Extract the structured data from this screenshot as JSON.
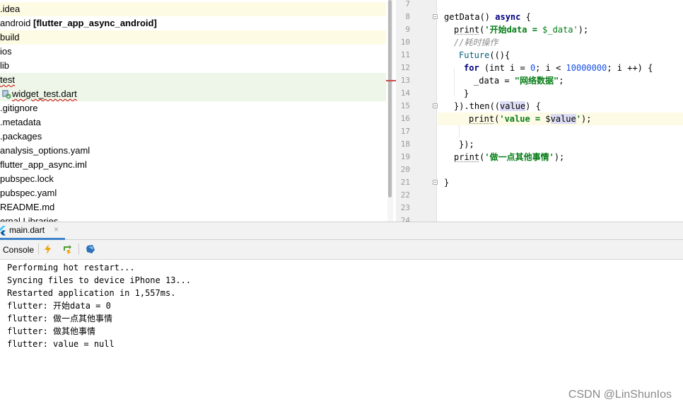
{
  "project_tree": {
    "items": [
      {
        "label": ".idea"
      },
      {
        "label": "android",
        "suffix": "[flutter_app_async_android]"
      },
      {
        "label": "build"
      },
      {
        "label": "ios"
      },
      {
        "label": "lib"
      },
      {
        "label": "test"
      },
      {
        "label": "widget_test.dart"
      },
      {
        "label": ".gitignore"
      },
      {
        "label": ".metadata"
      },
      {
        "label": ".packages"
      },
      {
        "label": "analysis_options.yaml"
      },
      {
        "label": "flutter_app_async.iml"
      },
      {
        "label": "pubspec.lock"
      },
      {
        "label": "pubspec.yaml"
      },
      {
        "label": "README.md"
      },
      {
        "label": "ernal Libraries"
      }
    ]
  },
  "editor": {
    "line_numbers": [
      "7",
      "8",
      "9",
      "10",
      "11",
      "12",
      "13",
      "14",
      "15",
      "16",
      "17",
      "18",
      "19",
      "20",
      "21",
      "22",
      "23",
      "24"
    ],
    "code": {
      "l8_a": "getData() ",
      "l8_kw": "async",
      "l8_b": " {",
      "l9_a": "print",
      "l9_b": "(",
      "l9_s": "'开始data = ",
      "l9_s2": "$_data'",
      "l9_c": ");",
      "l10": "//耗时操作",
      "l11_a": "Future",
      "l11_b": "((){",
      "l12_kw": "for",
      "l12_a": " (int i = ",
      "l12_n1": "0",
      "l12_b": "; i < ",
      "l12_n2": "10000000",
      "l12_c": "; i ++) {",
      "l13_a": "_data = ",
      "l13_s": "\"网络数据\"",
      "l13_b": ";",
      "l14": "}",
      "l15_a": "}).then((",
      "l15_v": "value",
      "l15_b": ") {",
      "l16_a": "print",
      "l16_b": "(",
      "l16_s": "'value = ",
      "l16_d": "$",
      "l16_v": "value",
      "l16_s2": "'",
      "l16_c": ");",
      "l18": "});",
      "l19_a": "print",
      "l19_b": "(",
      "l19_s": "'做一点其他事情'",
      "l19_c": ");",
      "l21": "}"
    }
  },
  "run_panel": {
    "tab_label": "main.dart",
    "tab_close": "×",
    "console_label": "Console",
    "output": [
      "Performing hot restart...",
      "Syncing files to device iPhone 13...",
      "Restarted application in 1,557ms.",
      "flutter: 开始data = 0",
      "flutter: 做一点其他事情",
      "flutter: 做其他事情",
      "flutter: value = null"
    ]
  },
  "watermark": "CSDN @LinShunIos",
  "colors": {
    "keyword": "#000080",
    "string": "#067d17",
    "number": "#1750eb",
    "comment": "#8c8c8c",
    "accent": "#4083c9"
  },
  "icons": {
    "tab": "flutter-icon",
    "toolbar": [
      "hot-reload-icon",
      "hot-restart-icon",
      "dart-devtools-icon"
    ],
    "file": "dart-test-file-icon"
  }
}
